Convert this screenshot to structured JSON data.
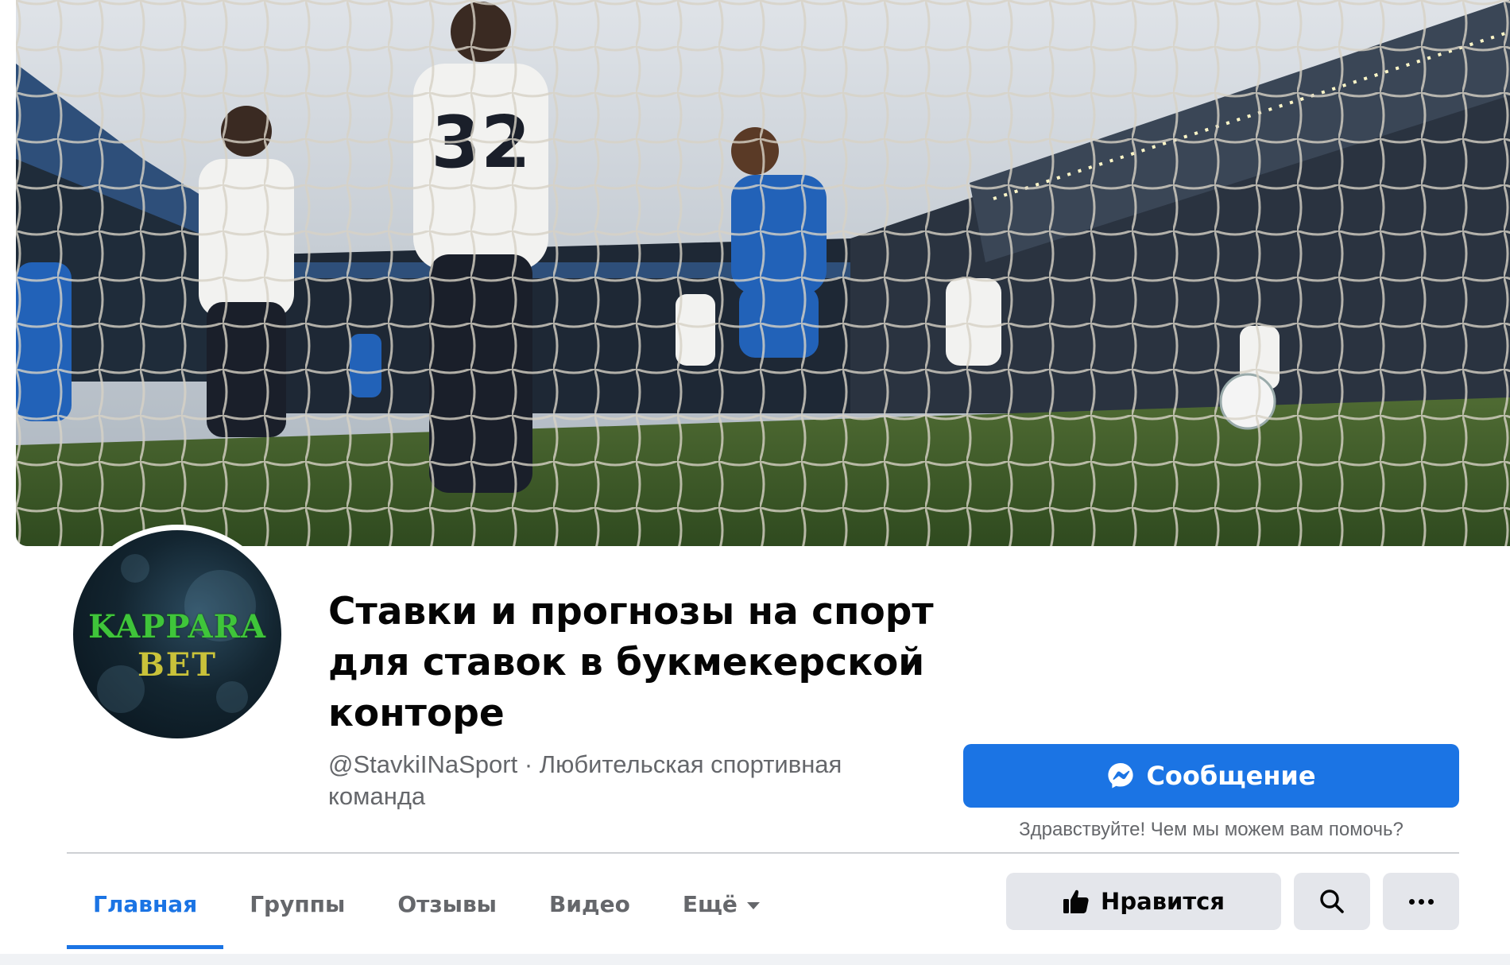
{
  "cover": {
    "image": "football-match-goal-net-photo"
  },
  "avatar": {
    "logo_line1": "KAPPARA",
    "logo_line2": "BET"
  },
  "page": {
    "title": "Ставки и прогнозы на спорт для ставок в букмекерской конторе",
    "subtitle": "@StavkiINaSport · Любительская спортивная команда"
  },
  "message": {
    "button_label": "Сообщение",
    "icon": "messenger-icon",
    "greeting": "Здравствуйте! Чем мы можем вам помочь?"
  },
  "tabs": [
    {
      "label": "Главная",
      "active": true
    },
    {
      "label": "Группы",
      "active": false
    },
    {
      "label": "Отзывы",
      "active": false
    },
    {
      "label": "Видео",
      "active": false
    },
    {
      "label": "Ещё",
      "active": false,
      "dropdown": true
    }
  ],
  "actions": {
    "like_label": "Нравится",
    "like_icon": "thumbs-up-icon",
    "search_icon": "search-icon",
    "more_icon": "more-dots-icon"
  },
  "colors": {
    "accent": "#1b74e4",
    "secondary_text": "#65676b",
    "button_gray": "#e4e6eb"
  }
}
